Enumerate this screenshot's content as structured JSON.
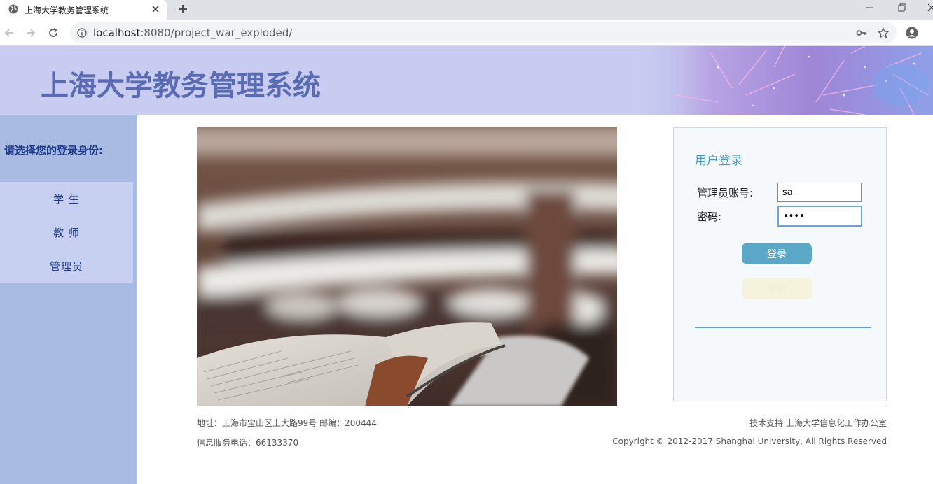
{
  "browser": {
    "tab_title": "上海大学教务管理系统",
    "url_host": "localhost",
    "url_rest": ":8080/project_war_exploded/"
  },
  "banner": {
    "title": "上海大学教务管理系统"
  },
  "sidebar": {
    "prompt": "请选择您的登录身份:",
    "items": [
      {
        "label": "学 生"
      },
      {
        "label": "教 师"
      },
      {
        "label": "管理员"
      }
    ]
  },
  "login": {
    "title": "用户登录",
    "account_label": "管理员账号:",
    "account_value": "sa",
    "password_label": "密码:",
    "password_value": "••••",
    "login_button": "登录",
    "reset_button": "重置"
  },
  "footer": {
    "address": "地址：上海市宝山区上大路99号 邮编：200444",
    "phone": "信息服务电话：66133370",
    "support": "技术支持 上海大学信息化工作办公室",
    "copyright": "Copyright © 2012-2017 Shanghai University, All Rights Reserved"
  },
  "colors": {
    "banner_bg": "#c7ccf0",
    "sidebar_bg": "#a9bbe2",
    "accent": "#5aa7c8"
  }
}
